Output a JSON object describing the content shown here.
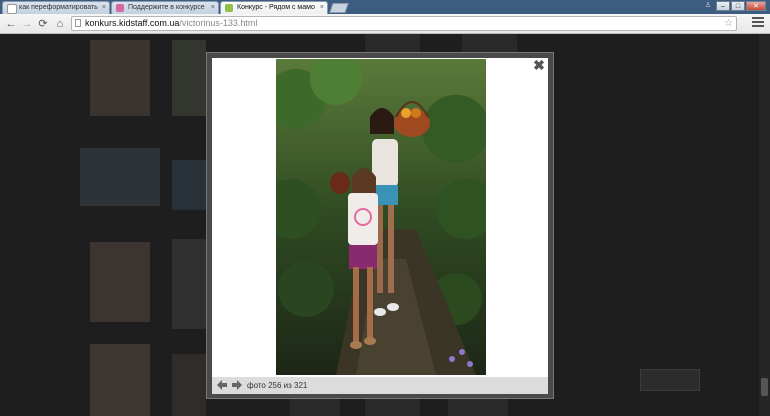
{
  "browser": {
    "tabs": [
      {
        "title": "как переформатировать",
        "favicon_color": "#ffffff",
        "active": false
      },
      {
        "title": "Поддержите в конкурсе",
        "favicon_color": "#d66aa0",
        "active": false
      },
      {
        "title": "Конкурс - Рядом с мамо",
        "favicon_color": "#8ec14a",
        "active": true
      }
    ],
    "tab_close_glyph": "×",
    "window_buttons": {
      "minimize": "–",
      "maximize": "□",
      "close": "✕"
    },
    "url_host": "konkurs.kidstaff.com.ua",
    "url_path": "/victorinus-133.html",
    "nav": {
      "back": "←",
      "forward": "→",
      "reload": "⟳",
      "home": "⌂"
    },
    "star_glyph": "☆"
  },
  "lightbox": {
    "close_glyph": "✖",
    "counter": "фото 256 из 321",
    "prev_glyph": "◀",
    "next_glyph": "▶"
  },
  "colors": {
    "overlay_bg": "#1e1e1e",
    "lightbox_frame": "#4a4a4a",
    "footer_bg": "#dcdcdc"
  }
}
